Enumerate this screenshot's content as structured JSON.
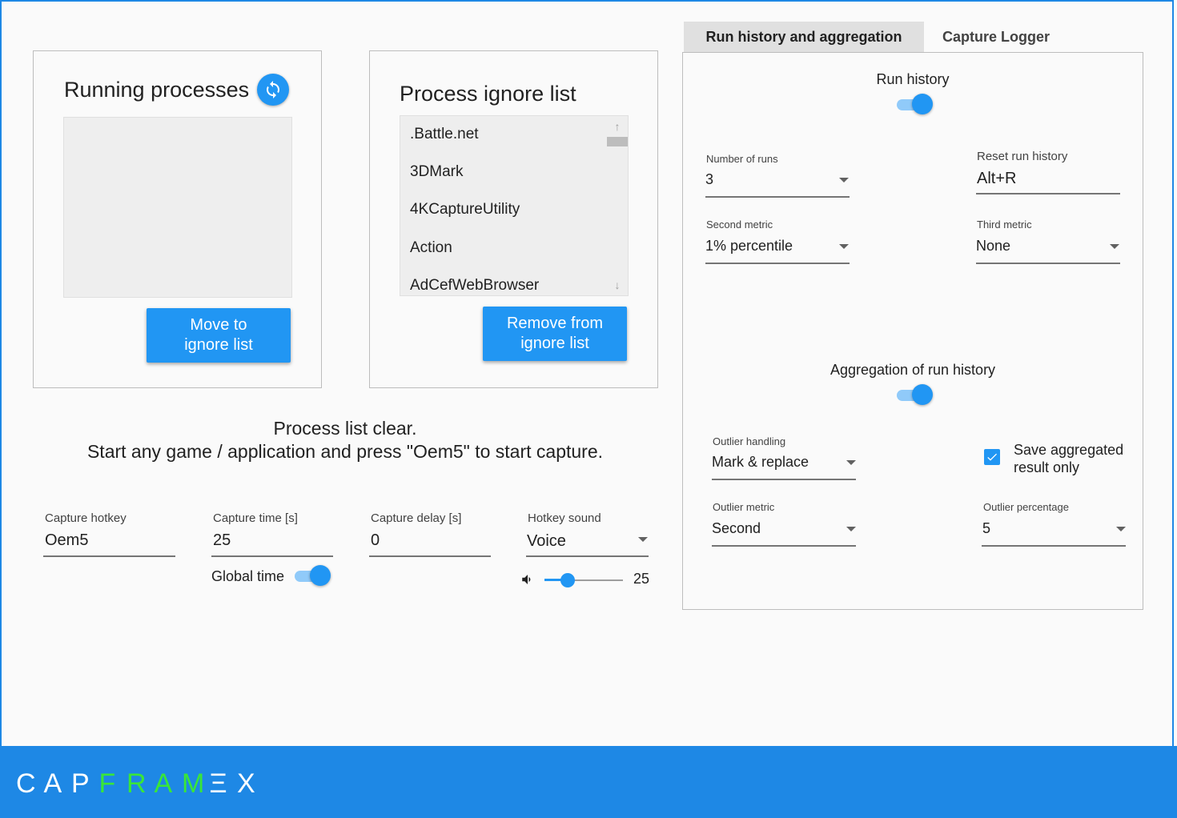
{
  "running_processes": {
    "title": "Running processes",
    "move_button": "Move to\nignore list"
  },
  "ignore_list": {
    "title": "Process ignore list",
    "items": [
      ".Battle.net",
      "3DMark",
      "4KCaptureUtility",
      "Action",
      "AdCefWebBrowser"
    ],
    "remove_button": "Remove from\nignore list"
  },
  "status": {
    "line1": "Process list clear.",
    "line2": "Start any game / application and press \"Oem5\" to start capture."
  },
  "capture": {
    "hotkey_label": "Capture hotkey",
    "hotkey_value": "Oem5",
    "time_label": "Capture time [s]",
    "time_value": "25",
    "delay_label": "Capture delay [s]",
    "delay_value": "0",
    "sound_label": "Hotkey sound",
    "sound_value": "Voice",
    "global_time_label": "Global time",
    "global_time_on": true,
    "volume_value": "25",
    "volume_fraction": 0.3
  },
  "tabs": [
    {
      "label": "Run history and aggregation",
      "active": true
    },
    {
      "label": "Capture Logger",
      "active": false
    }
  ],
  "run_history": {
    "title": "Run history",
    "enabled": true,
    "num_runs_label": "Number of runs",
    "num_runs_value": "3",
    "reset_label": "Reset run history",
    "reset_value": "Alt+R",
    "second_metric_label": "Second metric",
    "second_metric_value": "1% percentile",
    "third_metric_label": "Third metric",
    "third_metric_value": "None"
  },
  "aggregation": {
    "title": "Aggregation of run history",
    "enabled": true,
    "outlier_handling_label": "Outlier handling",
    "outlier_handling_value": "Mark & replace",
    "save_aggregated_label": "Save aggregated\nresult only",
    "save_aggregated_checked": true,
    "outlier_metric_label": "Outlier metric",
    "outlier_metric_value": "Second",
    "outlier_percentage_label": "Outlier percentage",
    "outlier_percentage_value": "5"
  },
  "logo": {
    "letters": [
      "C",
      "A",
      "P",
      "F",
      "R",
      "A",
      "M",
      "Ξ",
      "X"
    ],
    "white_color": "#ffffff",
    "green_color": "#39e639",
    "footer_color": "#1e88e5",
    "accent_color": "#2196f3"
  }
}
